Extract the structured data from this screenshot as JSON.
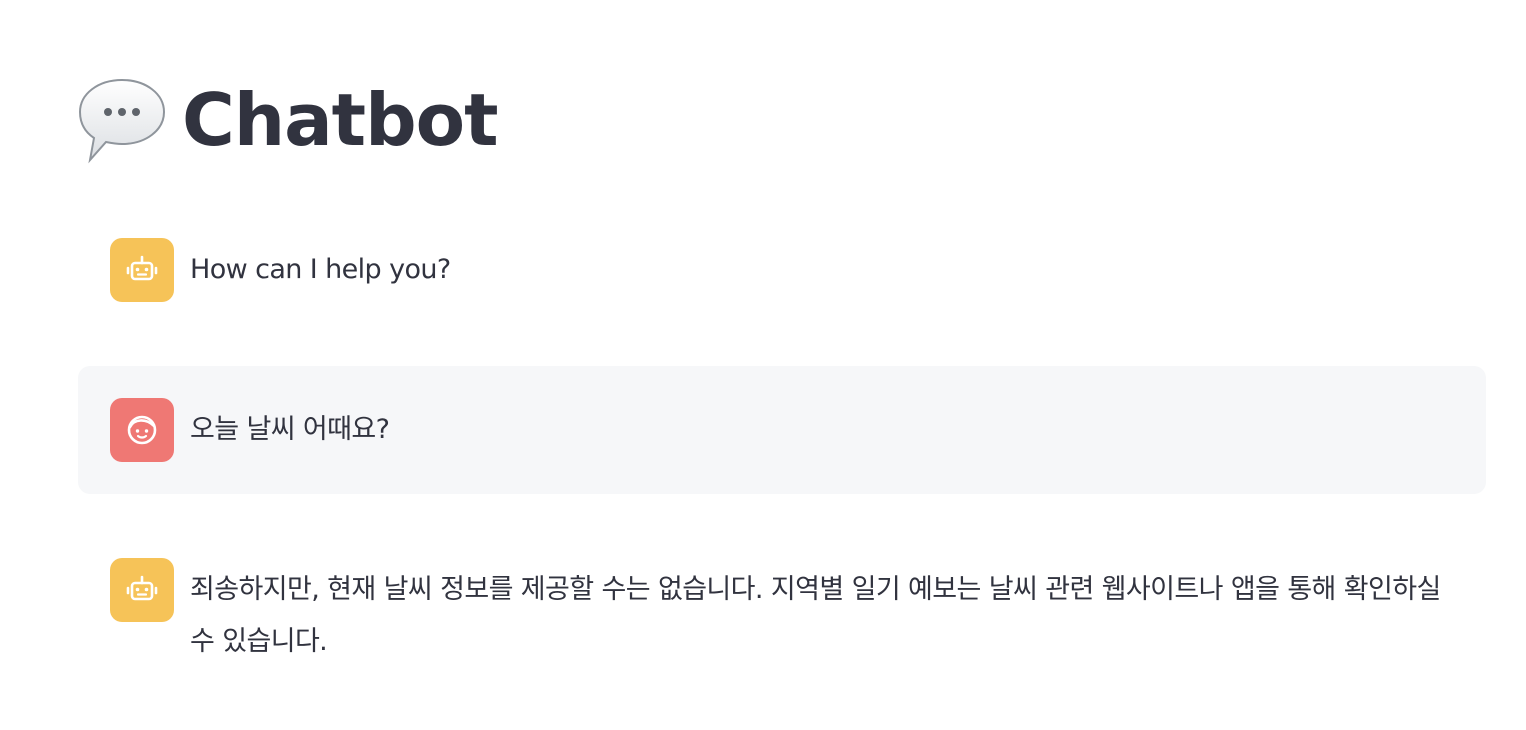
{
  "header": {
    "title": "Chatbot",
    "icon": "speech-bubble-icon"
  },
  "messages": [
    {
      "role": "assistant",
      "avatar_icon": "robot-icon",
      "avatar_color": "#f6c358",
      "text": "How can I help you?"
    },
    {
      "role": "user",
      "avatar_icon": "face-icon",
      "avatar_color": "#ef7874",
      "text": "오늘 날씨 어때요?"
    },
    {
      "role": "assistant",
      "avatar_icon": "robot-icon",
      "avatar_color": "#f6c358",
      "text": "죄송하지만, 현재 날씨 정보를 제공할 수는 없습니다. 지역별 일기 예보는 날씨 관련 웹사이트나 앱을 통해 확인하실 수 있습니다."
    }
  ],
  "colors": {
    "text": "#31333f",
    "user_bubble_bg": "#f6f7f9",
    "page_bg": "#ffffff"
  }
}
